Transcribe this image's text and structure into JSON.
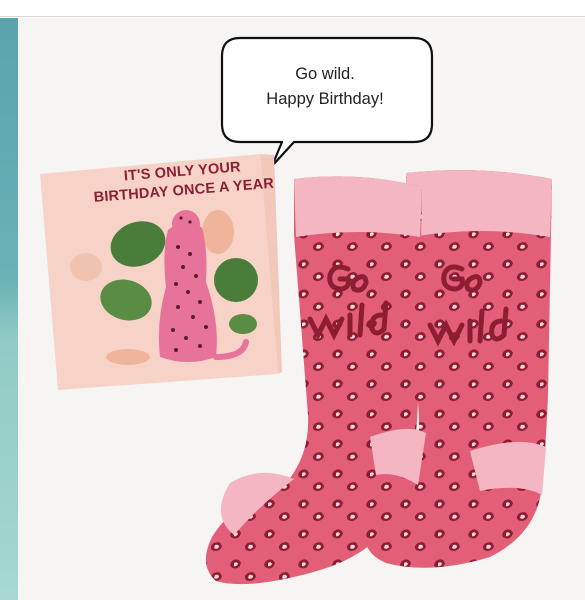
{
  "speech_bubble": {
    "line1": "Go wild.",
    "line2": "Happy Birthday!"
  },
  "card": {
    "title_line1": "IT'S ONLY YOUR",
    "title_line2": "BIRTHDAY ONCE A YEAR"
  },
  "colors": {
    "sock_pink": "#e35f78",
    "sock_light": "#f4b6c2",
    "leopard_dark": "#8c1d33",
    "card_bg": "#f7d3c7",
    "teal": "#6ab2b6",
    "leaf_green": "#4a7d3a"
  }
}
